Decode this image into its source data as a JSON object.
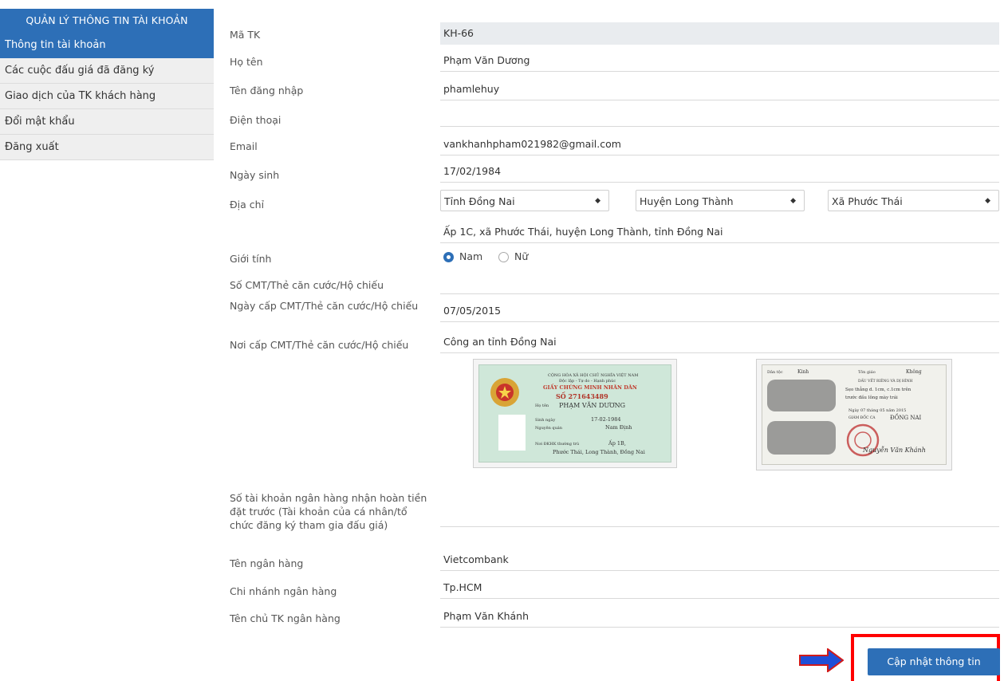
{
  "sidebar": {
    "header": "QUẢN LÝ THÔNG TIN TÀI KHOẢN",
    "items": [
      {
        "label": "Thông tin tài khoản"
      },
      {
        "label": "Các cuộc đấu giá đã đăng ký"
      },
      {
        "label": "Giao dịch của TK khách hàng"
      },
      {
        "label": "Đổi mật khẩu"
      },
      {
        "label": "Đăng xuất"
      }
    ]
  },
  "form": {
    "account_id": {
      "label": "Mã TK",
      "value": "KH-66"
    },
    "full_name": {
      "label": "Họ tên",
      "value": "Phạm Văn Dương"
    },
    "username": {
      "label": "Tên đăng nhập",
      "value": "phamlehuy"
    },
    "phone": {
      "label": "Điện thoại",
      "value": ""
    },
    "email": {
      "label": "Email",
      "value": "vankhanhpham021982@gmail.com"
    },
    "dob": {
      "label": "Ngày sinh",
      "value": "17/02/1984"
    },
    "address": {
      "label": "Địa chỉ",
      "province": "Tỉnh Đồng Nai",
      "district": "Huyện Long Thành",
      "ward": "Xã Phước Thái",
      "detail": "Ấp 1C, xã Phước Thái, huyện Long Thành, tỉnh Đồng Nai"
    },
    "gender": {
      "label": "Giới tính",
      "option_male": "Nam",
      "option_female": "Nữ",
      "selected": "Nam"
    },
    "id_number": {
      "label": "Số CMT/Thẻ căn cước/Hộ chiếu",
      "value": ""
    },
    "id_issue_date": {
      "label": "Ngày cấp CMT/Thẻ căn cước/Hộ chiếu",
      "value": "07/05/2015"
    },
    "id_issue_place": {
      "label": "Nơi cấp CMT/Thẻ căn cước/Hộ chiếu",
      "value": "Công an tỉnh Đồng Nai"
    },
    "bank_account": {
      "label": "Số tài khoản ngân hàng nhận hoàn tiền đặt trước (Tài khoản của cá nhân/tổ chức đăng ký tham gia đấu giá)",
      "value": ""
    },
    "bank_name": {
      "label": "Tên ngân hàng",
      "value": "Vietcombank"
    },
    "bank_branch": {
      "label": "Chi nhánh ngân hàng",
      "value": "Tp.HCM"
    },
    "bank_holder": {
      "label": "Tên chủ TK ngân hàng",
      "value": "Phạm Văn Khánh"
    }
  },
  "id_card_front": {
    "line1": "CỘNG HÒA XÃ HỘI CHỦ NGHĨA VIỆT NAM",
    "line2": "Độc lập - Tự do - Hạnh phúc",
    "title": "GIẤY CHỨNG MINH NHÂN DÂN",
    "number": "SỐ 271643489",
    "name_label": "Họ tên",
    "name": "PHẠM VĂN DƯƠNG",
    "dob_label": "Sinh ngày",
    "dob": "17-02-1984",
    "origin_label": "Nguyên quán",
    "origin": "Nam Định",
    "residence_label": "Nơi ĐKHK thường trú",
    "residence1": "Ấp 1B,",
    "residence2": "Phước Thái, Long Thành, Đồng Nai"
  },
  "id_card_back": {
    "ethnic_label": "Dân tộc",
    "ethnic": "Kinh",
    "religion_label": "Tôn giáo",
    "religion": "Không",
    "marks_header": "DẤU VẾT RIÊNG VÀ DỊ HÌNH",
    "marks1": "Sẹo thẳng d. 1cm, c.1cm trên",
    "marks2": "trước đầu lông mày trái",
    "date_line": "Ngày 07 tháng 05 năm 2015",
    "authority_label": "GIÁM ĐỐC CA",
    "province": "ĐỒNG NAI",
    "signer": "Nguyễn Văn Khánh"
  },
  "actions": {
    "update_label": "Cập nhật thông tin"
  },
  "colors": {
    "accent": "#2d6fb7",
    "highlight": "#ff0000",
    "arrow": "#1f4fd8"
  }
}
